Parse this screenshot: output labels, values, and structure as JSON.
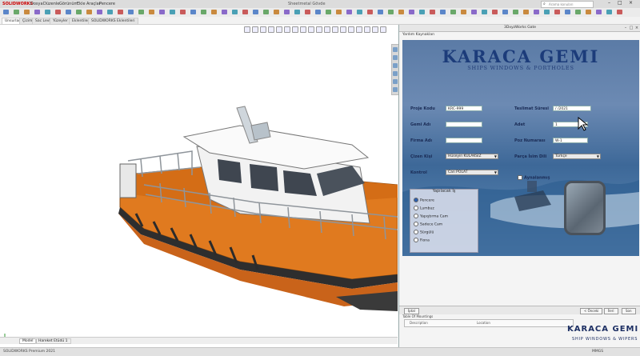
{
  "app": {
    "title": "SOLIDWORKS",
    "document_title": "Sheetmetal Gövde",
    "menu": [
      "Dosya",
      "Düzenle",
      "Görünüm",
      "Ekle",
      "Araçlar",
      "Pencere"
    ],
    "search_placeholder": "Arama konuları"
  },
  "tabs": [
    "Unsurlar",
    "Çizim",
    "Sac Levha",
    "Yüzeyler",
    "Eklentiler",
    "SOLIDWORKS Eklentileri"
  ],
  "bottom_tabs": [
    "Model",
    "Hareket Etüdü 1"
  ],
  "dialog": {
    "title": "3DxyzWorks Gate",
    "menu": "Yardım Kaynakları",
    "brand_title": "KARACA GEMI",
    "brand_subtitle": "SHIPS WINDOWS & PORTHOLES",
    "labels": {
      "proje_kodu": "Proje Kodu",
      "gemi_adi": "Gemi Adı",
      "firma_adi": "Firma Adı",
      "cizen_kisi": "Çizen Kişi",
      "kontrol": "Kontrol",
      "teslimat_suresi": "Teslimat Süresi",
      "adet": "Adet",
      "poz_numarasi": "Poz Numarası",
      "parca_isim_dili": "Parça İsim Dili",
      "aynalanmis": "Aynalanmış"
    },
    "values": {
      "proje_kodu": "KRC-999",
      "gemi_adi": "",
      "firma_adi": "",
      "cizen_kisi": "Hüseyin KULAKSIZ",
      "kontrol": "Can POLAT",
      "teslimat_suresi": "/ /2021",
      "adet": "1",
      "poz_numarasi": "W-1",
      "parca_isim_dili": "Türkçe"
    },
    "work_group": {
      "title": "Yapılacak İş",
      "options": [
        "Pencere",
        "Lumbuz",
        "Yapıştırma Cam",
        "Sadece Cam",
        "Sürgülü",
        "Fiona"
      ],
      "selected": "Pencere"
    },
    "buttons": {
      "cancel": "İptal",
      "previous": "< Önceki",
      "next": "İleri",
      "finish": "Son"
    },
    "table": {
      "caption": "Table Of Mountings",
      "columns": [
        "Description",
        "Location"
      ]
    },
    "footer_brand": "KARACA GEMI",
    "footer_subtitle": "SHIP WINDOWS & WIPERS"
  },
  "status": {
    "left": "SOLIDWORKS Premium 2021",
    "right": "MMGS"
  },
  "colors": {
    "hull_orange": "#e07a1f",
    "hull_dark": "#2a2a2a",
    "brand_blue": "#1c3c7a",
    "banner_blue": "#4f76a6"
  },
  "icons": [
    "close-icon",
    "minimize-icon",
    "maximize-icon",
    "search-icon",
    "cursor-icon",
    "view-orient-icon"
  ]
}
